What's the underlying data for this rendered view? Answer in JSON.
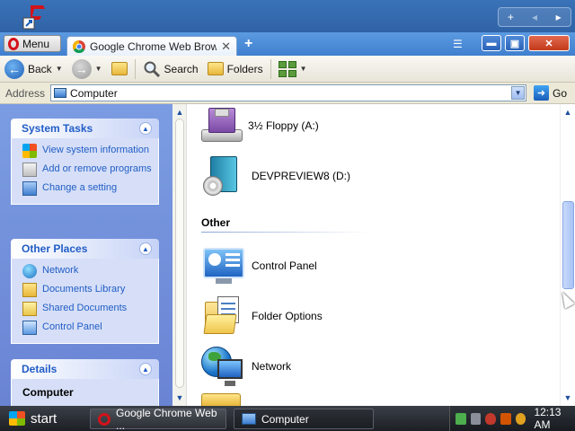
{
  "desktop": {
    "mini_controls": [
      "+",
      "◂",
      "▸"
    ]
  },
  "browser": {
    "menu_label": "Menu",
    "tab_title": "Google Chrome Web Brow",
    "tab_close": "✕",
    "new_tab": "+"
  },
  "toolbar": {
    "back_label": "Back",
    "search_label": "Search",
    "folders_label": "Folders"
  },
  "address": {
    "label": "Address",
    "value": "Computer",
    "go_label": "Go"
  },
  "taskpane": {
    "system_tasks": {
      "title": "System Tasks",
      "items": [
        {
          "label": "View system information",
          "icon": "windows-icon"
        },
        {
          "label": "Add or remove programs",
          "icon": "add-remove-icon"
        },
        {
          "label": "Change a setting",
          "icon": "settings-icon"
        }
      ]
    },
    "other_places": {
      "title": "Other Places",
      "items": [
        {
          "label": "Network",
          "icon": "network-icon"
        },
        {
          "label": "Documents Library",
          "icon": "library-icon"
        },
        {
          "label": "Shared Documents",
          "icon": "shared-docs-icon"
        },
        {
          "label": "Control Panel",
          "icon": "control-panel-icon"
        }
      ]
    },
    "details": {
      "title": "Details",
      "name": "Computer"
    }
  },
  "content": {
    "drives": [
      {
        "label": "3½ Floppy (A:)",
        "icon": "floppy-icon"
      },
      {
        "label": "DEVPREVIEW8 (D:)",
        "icon": "dvd-drive-icon"
      }
    ],
    "other_group": "Other",
    "other_items": [
      {
        "label": "Control Panel",
        "icon": "control-panel-icon"
      },
      {
        "label": "Folder Options",
        "icon": "folder-options-icon"
      },
      {
        "label": "Network",
        "icon": "network-icon"
      }
    ]
  },
  "taskbar": {
    "start_label": "start",
    "buttons": [
      {
        "label": "Google Chrome Web ...",
        "icon": "opera-icon"
      },
      {
        "label": "Computer",
        "icon": "computer-icon"
      }
    ],
    "clock": "12:13 AM"
  }
}
